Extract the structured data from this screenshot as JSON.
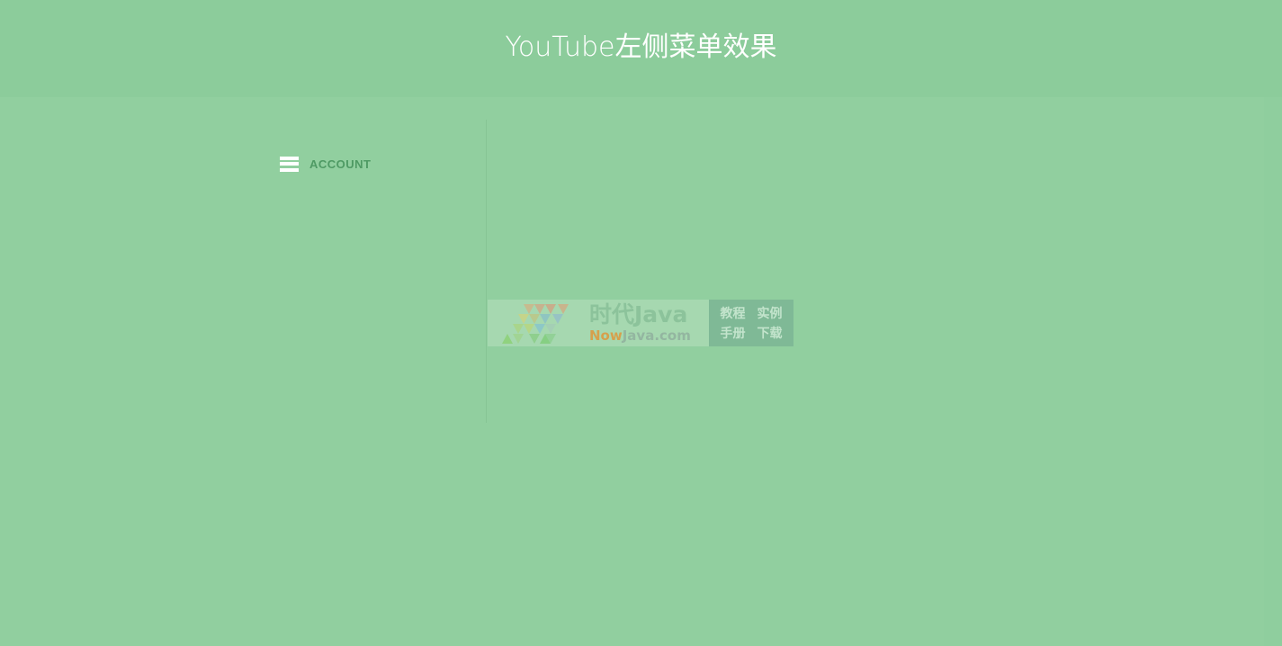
{
  "header": {
    "title": "YouTube左侧菜单效果"
  },
  "sidebar": {
    "items": [
      {
        "label": "ACCOUNT",
        "icon": "hamburger-menu-icon"
      }
    ]
  },
  "watermark": {
    "brand": "时代Java",
    "url_prefix": "Now",
    "url_suffix": "Java.com",
    "links": [
      "教程",
      "实例",
      "手册",
      "下载"
    ]
  },
  "colors": {
    "background": "#91cf9f",
    "header_background": "#8ccc9b",
    "title_text": "#ffffff",
    "menu_label": "#4f9a64"
  }
}
